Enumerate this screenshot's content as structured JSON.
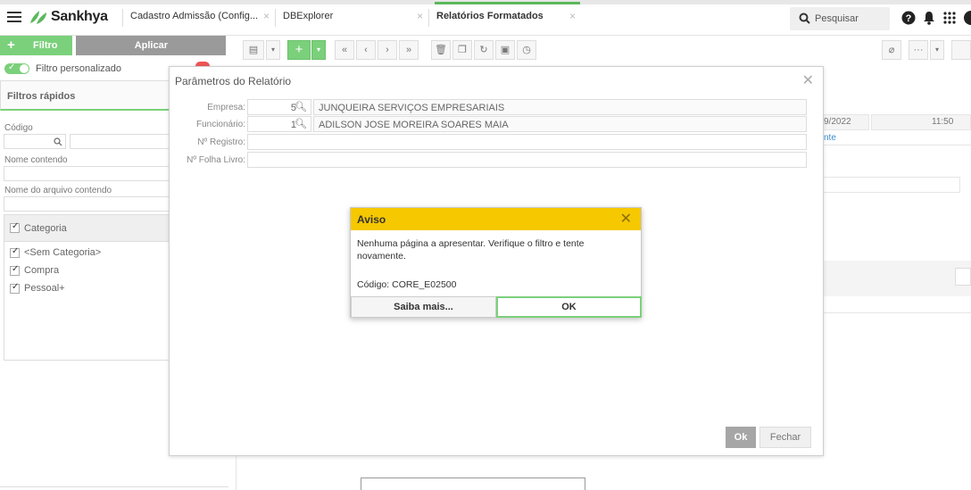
{
  "topbar": {
    "brand": "Sankhya",
    "tabs": [
      {
        "label": "Cadastro Admissão (Config...",
        "close": "×"
      },
      {
        "label": "DBExplorer",
        "close": "×"
      },
      {
        "label": "Relatórios Formatados",
        "close": "×"
      }
    ],
    "search_label": "Pesquisar",
    "accent": "#5cb85c"
  },
  "leftpanel": {
    "filter_button": "Filtro",
    "apply_button": "Aplicar",
    "custom_filter_label": "Filtro personalizado",
    "quick_filters_title": "Filtros rápidos",
    "code_label": "Código",
    "name_contains_label": "Nome contendo",
    "file_name_contains_label": "Nome do arquivo contendo",
    "category_header": "Categoria",
    "categories": [
      "<Sem Categoria>",
      "Compra",
      "Pessoal+"
    ]
  },
  "background": {
    "date_fragment": "9/2022",
    "time_fragment": "11:50",
    "link_fragment": "nte"
  },
  "modal": {
    "title": "Parâmetros do Relatório",
    "fields": [
      {
        "label": "Empresa:",
        "code": "5",
        "value": "JUNQUEIRA SERVIÇOS EMPRESARIAIS"
      },
      {
        "label": "Funcionário:",
        "code": "1",
        "value": "ADILSON JOSE MOREIRA SOARES MAIA"
      },
      {
        "label": "Nº Registro:",
        "value": ""
      },
      {
        "label": "Nº Folha Livro:",
        "value": ""
      }
    ],
    "ok_button": "Ok",
    "close_button": "Fechar"
  },
  "alert": {
    "title": "Aviso",
    "message": "Nenhuma página a apresentar. Verifique o filtro e tente novamente.",
    "code": "Código: CORE_E02500",
    "more_button": "Saiba mais...",
    "ok_button": "OK",
    "header_color": "#f5c800"
  }
}
